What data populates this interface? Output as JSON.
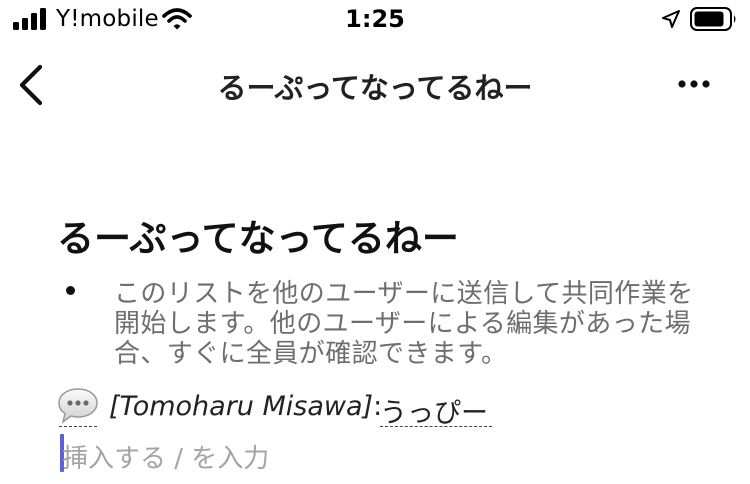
{
  "status_bar": {
    "carrier": "Y!mobile",
    "time": "1:25",
    "icons": [
      "signal-icon",
      "wifi-icon",
      "location-arrow-icon",
      "battery-icon"
    ]
  },
  "nav": {
    "title": "るーぷってなってるねー",
    "icons": [
      "chevron-left-icon",
      "ellipsis-icon"
    ]
  },
  "document": {
    "title": "るーぷってなってるねー",
    "bullet_text": "このリストを他のユーザーに送信して共同作業を開始します。他のユーザーによる編集があった場合、すぐに全員が確認できます。",
    "comment": {
      "icon": "speech-bubble-icon",
      "author": "[Tomoharu Misawa]",
      "separator": ":",
      "text": "うっぴー"
    },
    "input_placeholder": "挿入する / を入力"
  },
  "colors": {
    "accent_cursor": "#5b5fd8",
    "secondary_text": "#6e6e6e",
    "placeholder_text": "#a4a4a4"
  }
}
